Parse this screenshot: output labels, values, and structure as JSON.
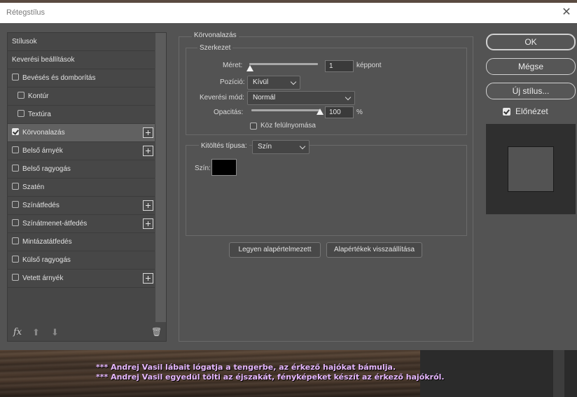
{
  "window": {
    "title": "Rétegstílus",
    "close_glyph": "✕"
  },
  "styles_list": [
    {
      "label": "Stílusok",
      "checkbox": false,
      "checked": false,
      "selected": false,
      "add": false,
      "indent": false
    },
    {
      "label": "Keverési beállítások",
      "checkbox": false,
      "checked": false,
      "selected": false,
      "add": false,
      "indent": false
    },
    {
      "label": "Bevésés és domborítás",
      "checkbox": true,
      "checked": false,
      "selected": false,
      "add": false,
      "indent": false
    },
    {
      "label": "Kontúr",
      "checkbox": true,
      "checked": false,
      "selected": false,
      "add": false,
      "indent": true
    },
    {
      "label": "Textúra",
      "checkbox": true,
      "checked": false,
      "selected": false,
      "add": false,
      "indent": true
    },
    {
      "label": "Körvonalazás",
      "checkbox": true,
      "checked": true,
      "selected": true,
      "add": true,
      "indent": false
    },
    {
      "label": "Belső árnyék",
      "checkbox": true,
      "checked": false,
      "selected": false,
      "add": true,
      "indent": false
    },
    {
      "label": "Belső ragyogás",
      "checkbox": true,
      "checked": false,
      "selected": false,
      "add": false,
      "indent": false
    },
    {
      "label": "Szatén",
      "checkbox": true,
      "checked": false,
      "selected": false,
      "add": false,
      "indent": false
    },
    {
      "label": "Színátfedés",
      "checkbox": true,
      "checked": false,
      "selected": false,
      "add": true,
      "indent": false
    },
    {
      "label": "Színátmenet-átfedés",
      "checkbox": true,
      "checked": false,
      "selected": false,
      "add": true,
      "indent": false
    },
    {
      "label": "Mintázatátfedés",
      "checkbox": true,
      "checked": false,
      "selected": false,
      "add": false,
      "indent": false
    },
    {
      "label": "Külső ragyogás",
      "checkbox": true,
      "checked": false,
      "selected": false,
      "add": false,
      "indent": false
    },
    {
      "label": "Vetett árnyék",
      "checkbox": true,
      "checked": false,
      "selected": false,
      "add": true,
      "indent": false
    }
  ],
  "list_toolbar": {
    "fx": "fx",
    "up": "⬆",
    "down": "⬇",
    "trash": "🗑"
  },
  "stroke": {
    "section_title": "Körvonalazás",
    "structure_title": "Szerkezet",
    "size_label": "Méret:",
    "size_value": "1",
    "size_unit": "képpont",
    "size_fraction": 0.0,
    "position_label": "Pozíció:",
    "position_value": "Kívül",
    "blend_label": "Keverési mód:",
    "blend_value": "Normál",
    "opacity_label": "Opacitás:",
    "opacity_value": "100",
    "opacity_unit": "%",
    "opacity_fraction": 1.0,
    "overprint_label": "Köz felülnyomása",
    "fill_type_label": "Kitöltés típusa:",
    "fill_type_value": "Szín",
    "color_label": "Szín:",
    "color_value": "#000000",
    "make_default": "Legyen alapértelmezett",
    "reset_default": "Alapértékek visszaállítása"
  },
  "actions": {
    "ok": "OK",
    "cancel": "Mégse",
    "new_style": "Új stílus...",
    "preview_label": "Előnézet"
  },
  "overlay_chat": [
    "*** Andrej Vasil lábait lógatja a tengerbe, az érkező hajókat bámulja.",
    "*** Andrej Vasil egyedül tölti az éjszakát, fényképeket készít az érkező hajókról."
  ]
}
